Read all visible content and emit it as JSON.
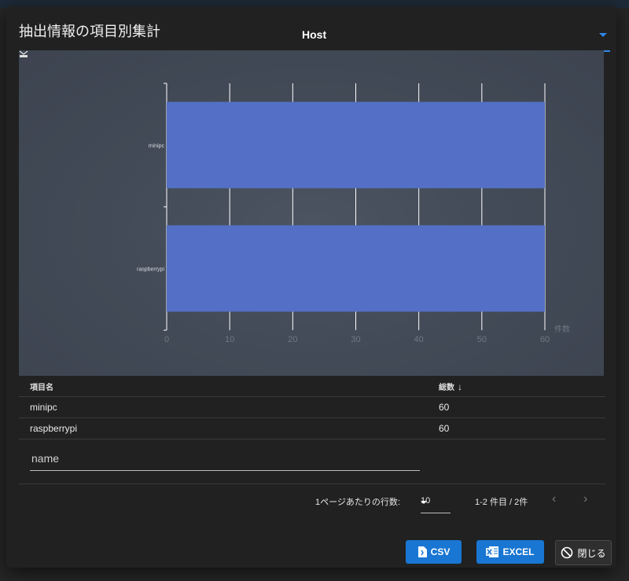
{
  "dialog": {
    "title": "抽出情報の項目別集計",
    "field_select": {
      "value": "Host"
    }
  },
  "chart_data": {
    "type": "bar",
    "orientation": "horizontal",
    "categories": [
      "minipc",
      "raspberrypi"
    ],
    "values": [
      60,
      60
    ],
    "xlabel": "件数",
    "xlim": [
      0,
      60
    ],
    "xticks": [
      0,
      10,
      20,
      30,
      40,
      50,
      60
    ],
    "grid": true,
    "bar_color": "#5470c6"
  },
  "table": {
    "headers": {
      "name": "項目名",
      "total": "総数"
    },
    "sort_icon": "arrow-down-icon",
    "rows": [
      {
        "name": "minipc",
        "total": "60"
      },
      {
        "name": "raspberrypi",
        "total": "60"
      }
    ]
  },
  "filter": {
    "placeholder": "name",
    "value": ""
  },
  "pagination": {
    "rows_per_page_label": "1ページあたりの行数:",
    "rows_per_page": "10",
    "range": "1-2 件目 / 2件",
    "prev_icon": "chevron-left-icon",
    "next_icon": "chevron-right-icon"
  },
  "buttons": {
    "csv": "CSV",
    "excel": "EXCEL",
    "close": "閉じる"
  },
  "colors": {
    "accent": "#1976d2",
    "underline": "#2e87e8",
    "bar": "#5470c6"
  }
}
